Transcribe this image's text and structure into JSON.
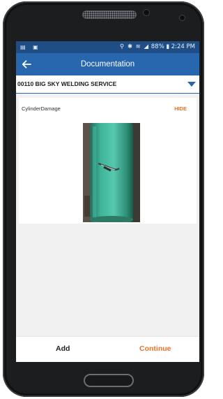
{
  "status_bar": {
    "left_icons": "▤ ▣",
    "icons": "⚲ ✱ ≋ ◢",
    "battery": "88%",
    "time": "2:24 PM"
  },
  "app_bar": {
    "back_icon": "arrow-left-icon",
    "title": "Documentation"
  },
  "company": {
    "label": "00110  BIG SKY WELDING SERVICE",
    "dropdown_icon": "triangle-down-icon"
  },
  "document": {
    "name": "CylinderDamage",
    "toggle_label": "HIDE"
  },
  "bottom_bar": {
    "add_label": "Add",
    "continue_label": "Continue"
  },
  "colors": {
    "status_bar": "#1f4e87",
    "app_bar": "#2866ad",
    "accent": "#e8742b"
  }
}
